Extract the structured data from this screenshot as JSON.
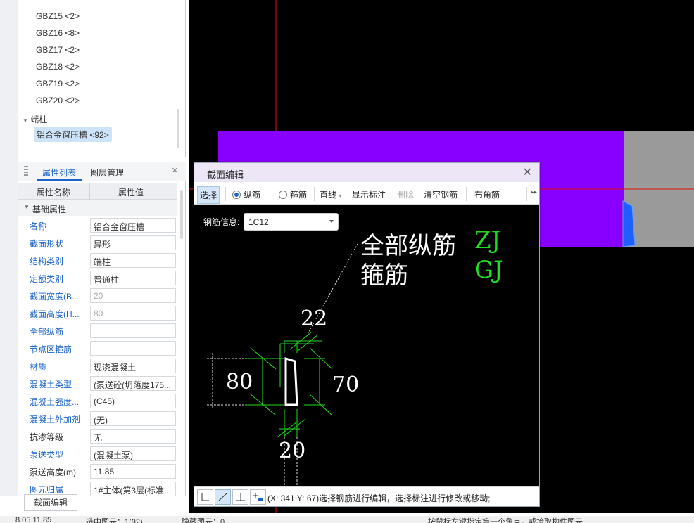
{
  "tree": {
    "items": [
      "GBZ15 <2>",
      "GBZ16 <8>",
      "GBZ17 <2>",
      "GBZ18 <2>",
      "GBZ19 <2>",
      "GBZ20 <2>"
    ],
    "group": "端柱",
    "selected": "铝合金窗压槽 <92>"
  },
  "props": {
    "tab_active": "属性列表",
    "tab_other": "图层管理",
    "col_name": "属性名称",
    "col_value": "属性值",
    "group": "基础属性",
    "rows": [
      {
        "name": "名称",
        "value": "铝合金窗压槽"
      },
      {
        "name": "截面形状",
        "value": "异形"
      },
      {
        "name": "结构类别",
        "value": "端柱"
      },
      {
        "name": "定额类别",
        "value": "普通柱"
      },
      {
        "name": "截面宽度(B...",
        "value": "20"
      },
      {
        "name": "截面高度(H...",
        "value": "80"
      },
      {
        "name": "全部纵筋",
        "value": ""
      },
      {
        "name": "节点区箍筋",
        "value": ""
      },
      {
        "name": "材质",
        "value": "现浇混凝土"
      },
      {
        "name": "混凝土类型",
        "value": "(泵送砼(坍落度175..."
      },
      {
        "name": "混凝土强度...",
        "value": "(C45)"
      },
      {
        "name": "混凝土外加剂",
        "value": "(无)"
      },
      {
        "name": "抗渗等级",
        "value": "无"
      },
      {
        "name": "泵送类型",
        "value": "(混凝土泵)"
      },
      {
        "name": "泵送高度(m)",
        "value": "11.85"
      },
      {
        "name": "图元归属",
        "value": "1#主体(第3层(标准..."
      }
    ],
    "bottom_button": "截面编辑"
  },
  "dialog": {
    "title": "截面编辑",
    "toolbar": {
      "select": "选择",
      "longitudinal": "纵筋",
      "stirrup": "箍筋",
      "line": "直线",
      "show_dim": "显示标注",
      "delete": "删除",
      "clear": "清空钢筋",
      "corner": "布角筋"
    },
    "rebar_label": "钢筋信息:",
    "rebar_value": "1C12",
    "canvas": {
      "all_longitudinal": "全部纵筋",
      "all_longitudinal_code": "ZJ",
      "stirrup": "箍筋",
      "stirrup_code": "GJ",
      "dim_top": "22",
      "dim_left": "80",
      "dim_right": "70",
      "dim_bottom": "20"
    },
    "status": "(X: 341 Y: 67)选择钢筋进行编辑，选择标注进行修改或移动;"
  },
  "statusbar": {
    "coord": "8.05 11.85",
    "selected": "选中图元：1(92)",
    "hidden": "隐藏图元：0",
    "hint": "按鼠标左键指定第一个角点，或拾取构件图元"
  },
  "colors": {
    "accent": "#1a63c9",
    "purple": "#8800ff",
    "green": "#22dd22"
  }
}
